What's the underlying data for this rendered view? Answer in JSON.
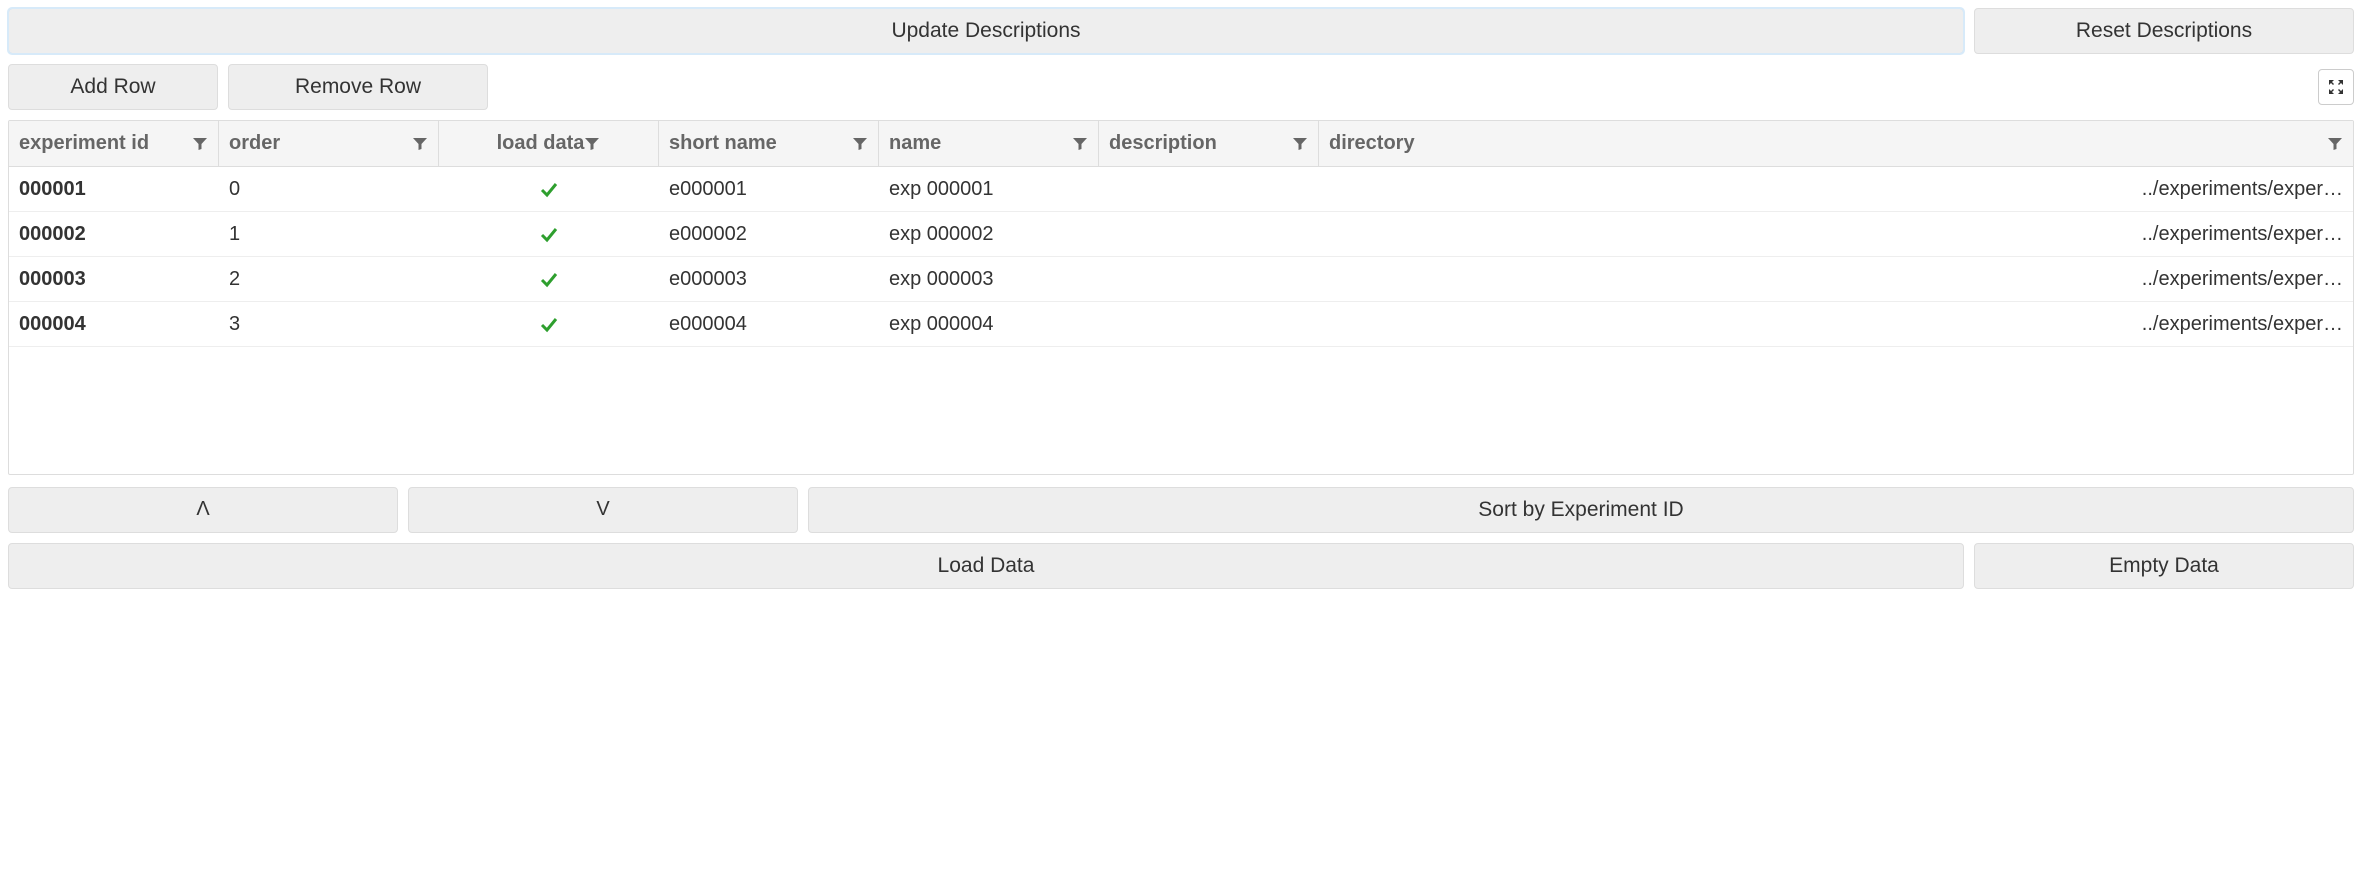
{
  "topButtons": {
    "update": "Update Descriptions",
    "reset": "Reset Descriptions"
  },
  "rowButtons": {
    "add": "Add Row",
    "remove": "Remove Row"
  },
  "columns": [
    "experiment id",
    "order",
    "load data",
    "short name",
    "name",
    "description",
    "directory"
  ],
  "rows": [
    {
      "experiment_id": "000001",
      "order": "0",
      "load_data": true,
      "short_name": "e000001",
      "name": "exp 000001",
      "description": "",
      "directory": "../experiments/exper…"
    },
    {
      "experiment_id": "000002",
      "order": "1",
      "load_data": true,
      "short_name": "e000002",
      "name": "exp 000002",
      "description": "",
      "directory": "../experiments/exper…"
    },
    {
      "experiment_id": "000003",
      "order": "2",
      "load_data": true,
      "short_name": "e000003",
      "name": "exp 000003",
      "description": "",
      "directory": "../experiments/exper…"
    },
    {
      "experiment_id": "000004",
      "order": "3",
      "load_data": true,
      "short_name": "e000004",
      "name": "exp 000004",
      "description": "",
      "directory": "../experiments/exper…"
    }
  ],
  "moveButtons": {
    "up": "Ʌ",
    "down": "V",
    "sort": "Sort by Experiment ID"
  },
  "dataButtons": {
    "load": "Load Data",
    "empty": "Empty Data"
  }
}
